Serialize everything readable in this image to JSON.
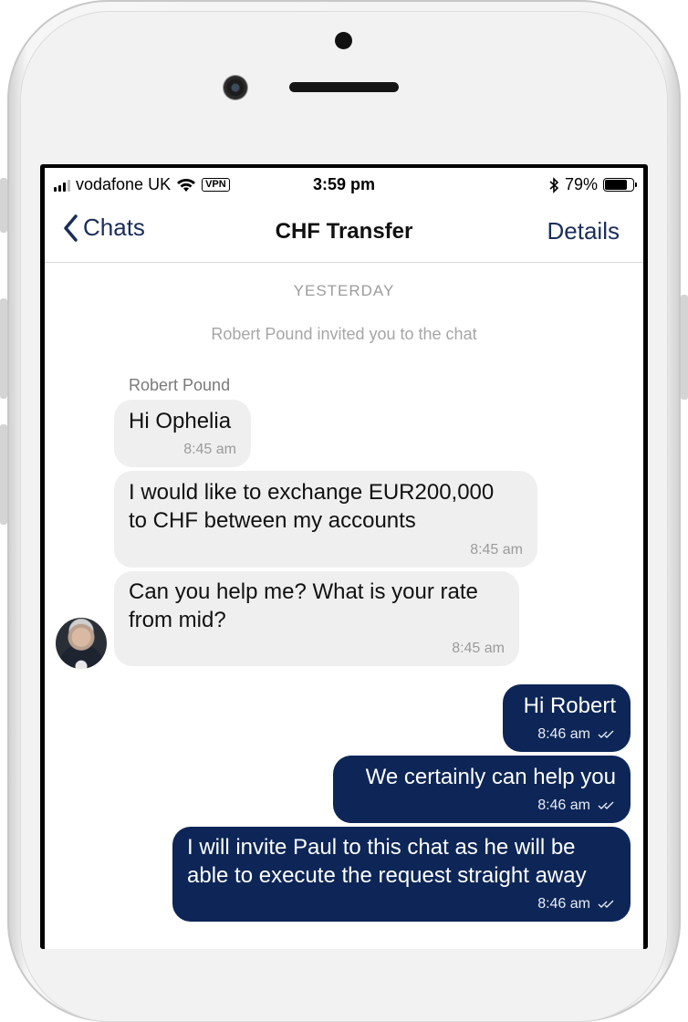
{
  "status_bar": {
    "carrier": "vodafone UK",
    "vpn": "VPN",
    "time": "3:59 pm",
    "battery": "79%",
    "battery_level": 0.79,
    "icons": [
      "signal-icon",
      "wifi-icon",
      "bluetooth-icon",
      "battery-icon"
    ]
  },
  "nav": {
    "back_label": "Chats",
    "title": "CHF Transfer",
    "details_label": "Details"
  },
  "chat": {
    "date_separator": "YESTERDAY",
    "system_message": "Robert Pound invited you to the chat",
    "sender_name": "Robert Pound",
    "messages": [
      {
        "direction": "in",
        "lines": [
          "Hi Ophelia"
        ],
        "time": "8:45 am"
      },
      {
        "direction": "in",
        "lines": [
          "I would like to exchange EUR200,000",
          "to CHF between my accounts"
        ],
        "time": "8:45 am"
      },
      {
        "direction": "in",
        "lines": [
          "Can you help me? What is your rate",
          "from mid?"
        ],
        "time": "8:45 am"
      },
      {
        "direction": "out",
        "lines": [
          "Hi Robert"
        ],
        "time": "8:46 am",
        "status": "read-receipt-icon"
      },
      {
        "direction": "out",
        "lines": [
          "We certainly can help you"
        ],
        "time": "8:46 am",
        "status": "read-receipt-icon"
      },
      {
        "direction": "out",
        "lines": [
          "I will invite Paul to this chat as he will be",
          "able to execute the request straight away"
        ],
        "time": "8:46 am",
        "status": "read-receipt-icon"
      }
    ]
  },
  "colors": {
    "accent": "#1a2e5a",
    "outgoing_bubble": "#0d2657",
    "incoming_bubble": "#efefef",
    "muted_text": "#9c9c9c"
  }
}
